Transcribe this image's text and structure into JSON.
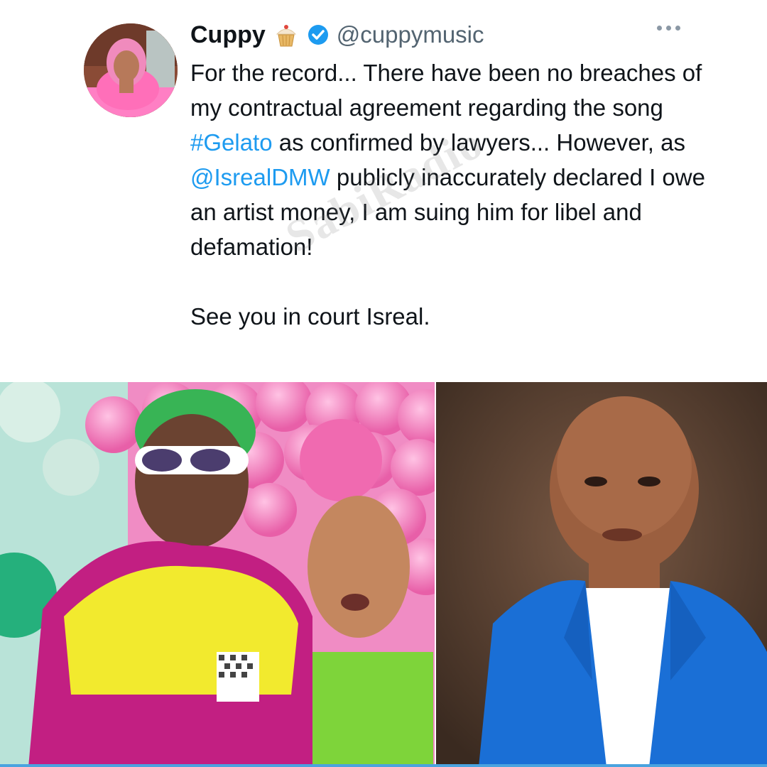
{
  "tweet": {
    "author": {
      "display_name": "Cuppy",
      "emoji_icon": "cupcake-icon",
      "verified_icon": "verified-badge-icon",
      "handle": "@cuppymusic",
      "avatar_icon": "avatar-photo"
    },
    "more_icon": "more-options-icon",
    "text": {
      "part1": "For the record... There have been no breaches of my contractual agreement regarding the song ",
      "hashtag": "#Gelato",
      "part2": " as confirmed by lawyers... However, as ",
      "mention": "@IsrealDMW",
      "part3": " publicly inaccurately declared I owe an artist money, I am suing him for libel and defamation!",
      "closing": "See you in court Isreal."
    },
    "watermark": "SabiRadio"
  },
  "media": {
    "left_photo_icon": "music-video-still-photo",
    "right_photo_icon": "portrait-photo"
  },
  "colors": {
    "link": "#1d9bf0",
    "verified": "#1d9bf0",
    "pink_background": "#e85fa8",
    "blazer_blue": "#1a6fd6"
  }
}
